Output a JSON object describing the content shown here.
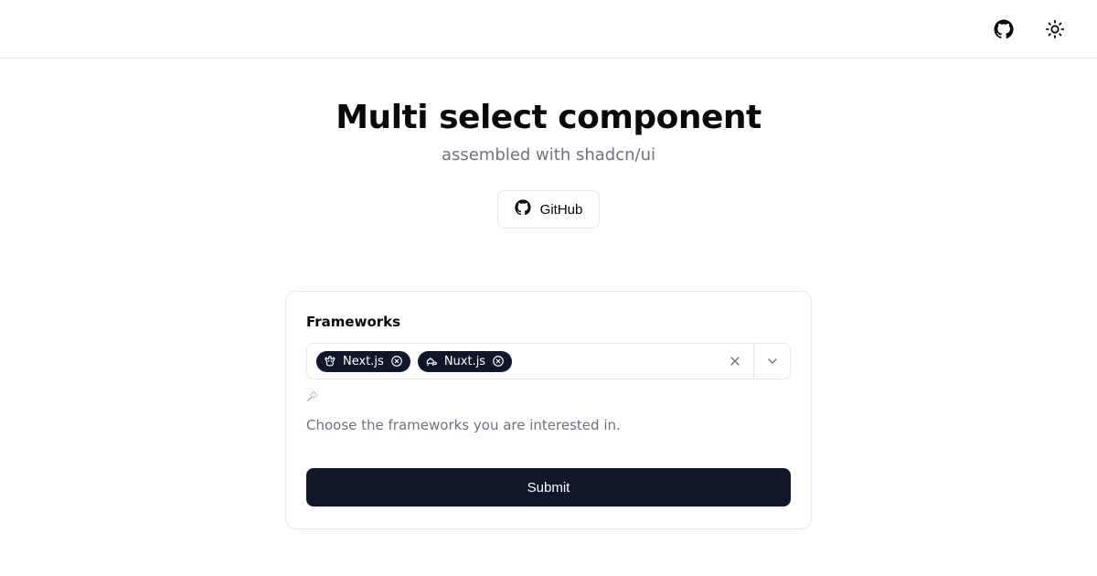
{
  "header": {
    "title": "Multi select component",
    "subtitle": "assembled with shadcn/ui",
    "github_label": "GitHub"
  },
  "form": {
    "field_label": "Frameworks",
    "helper": "Choose the frameworks you are interested in.",
    "submit_label": "Submit",
    "selected": [
      {
        "label": "Next.js",
        "icon": "dog"
      },
      {
        "label": "Nuxt.js",
        "icon": "turtle"
      }
    ]
  },
  "colors": {
    "chip_bg": "#0f172a",
    "submit_bg": "#0f172a",
    "border": "#e5e7eb",
    "muted": "#6b7280"
  }
}
